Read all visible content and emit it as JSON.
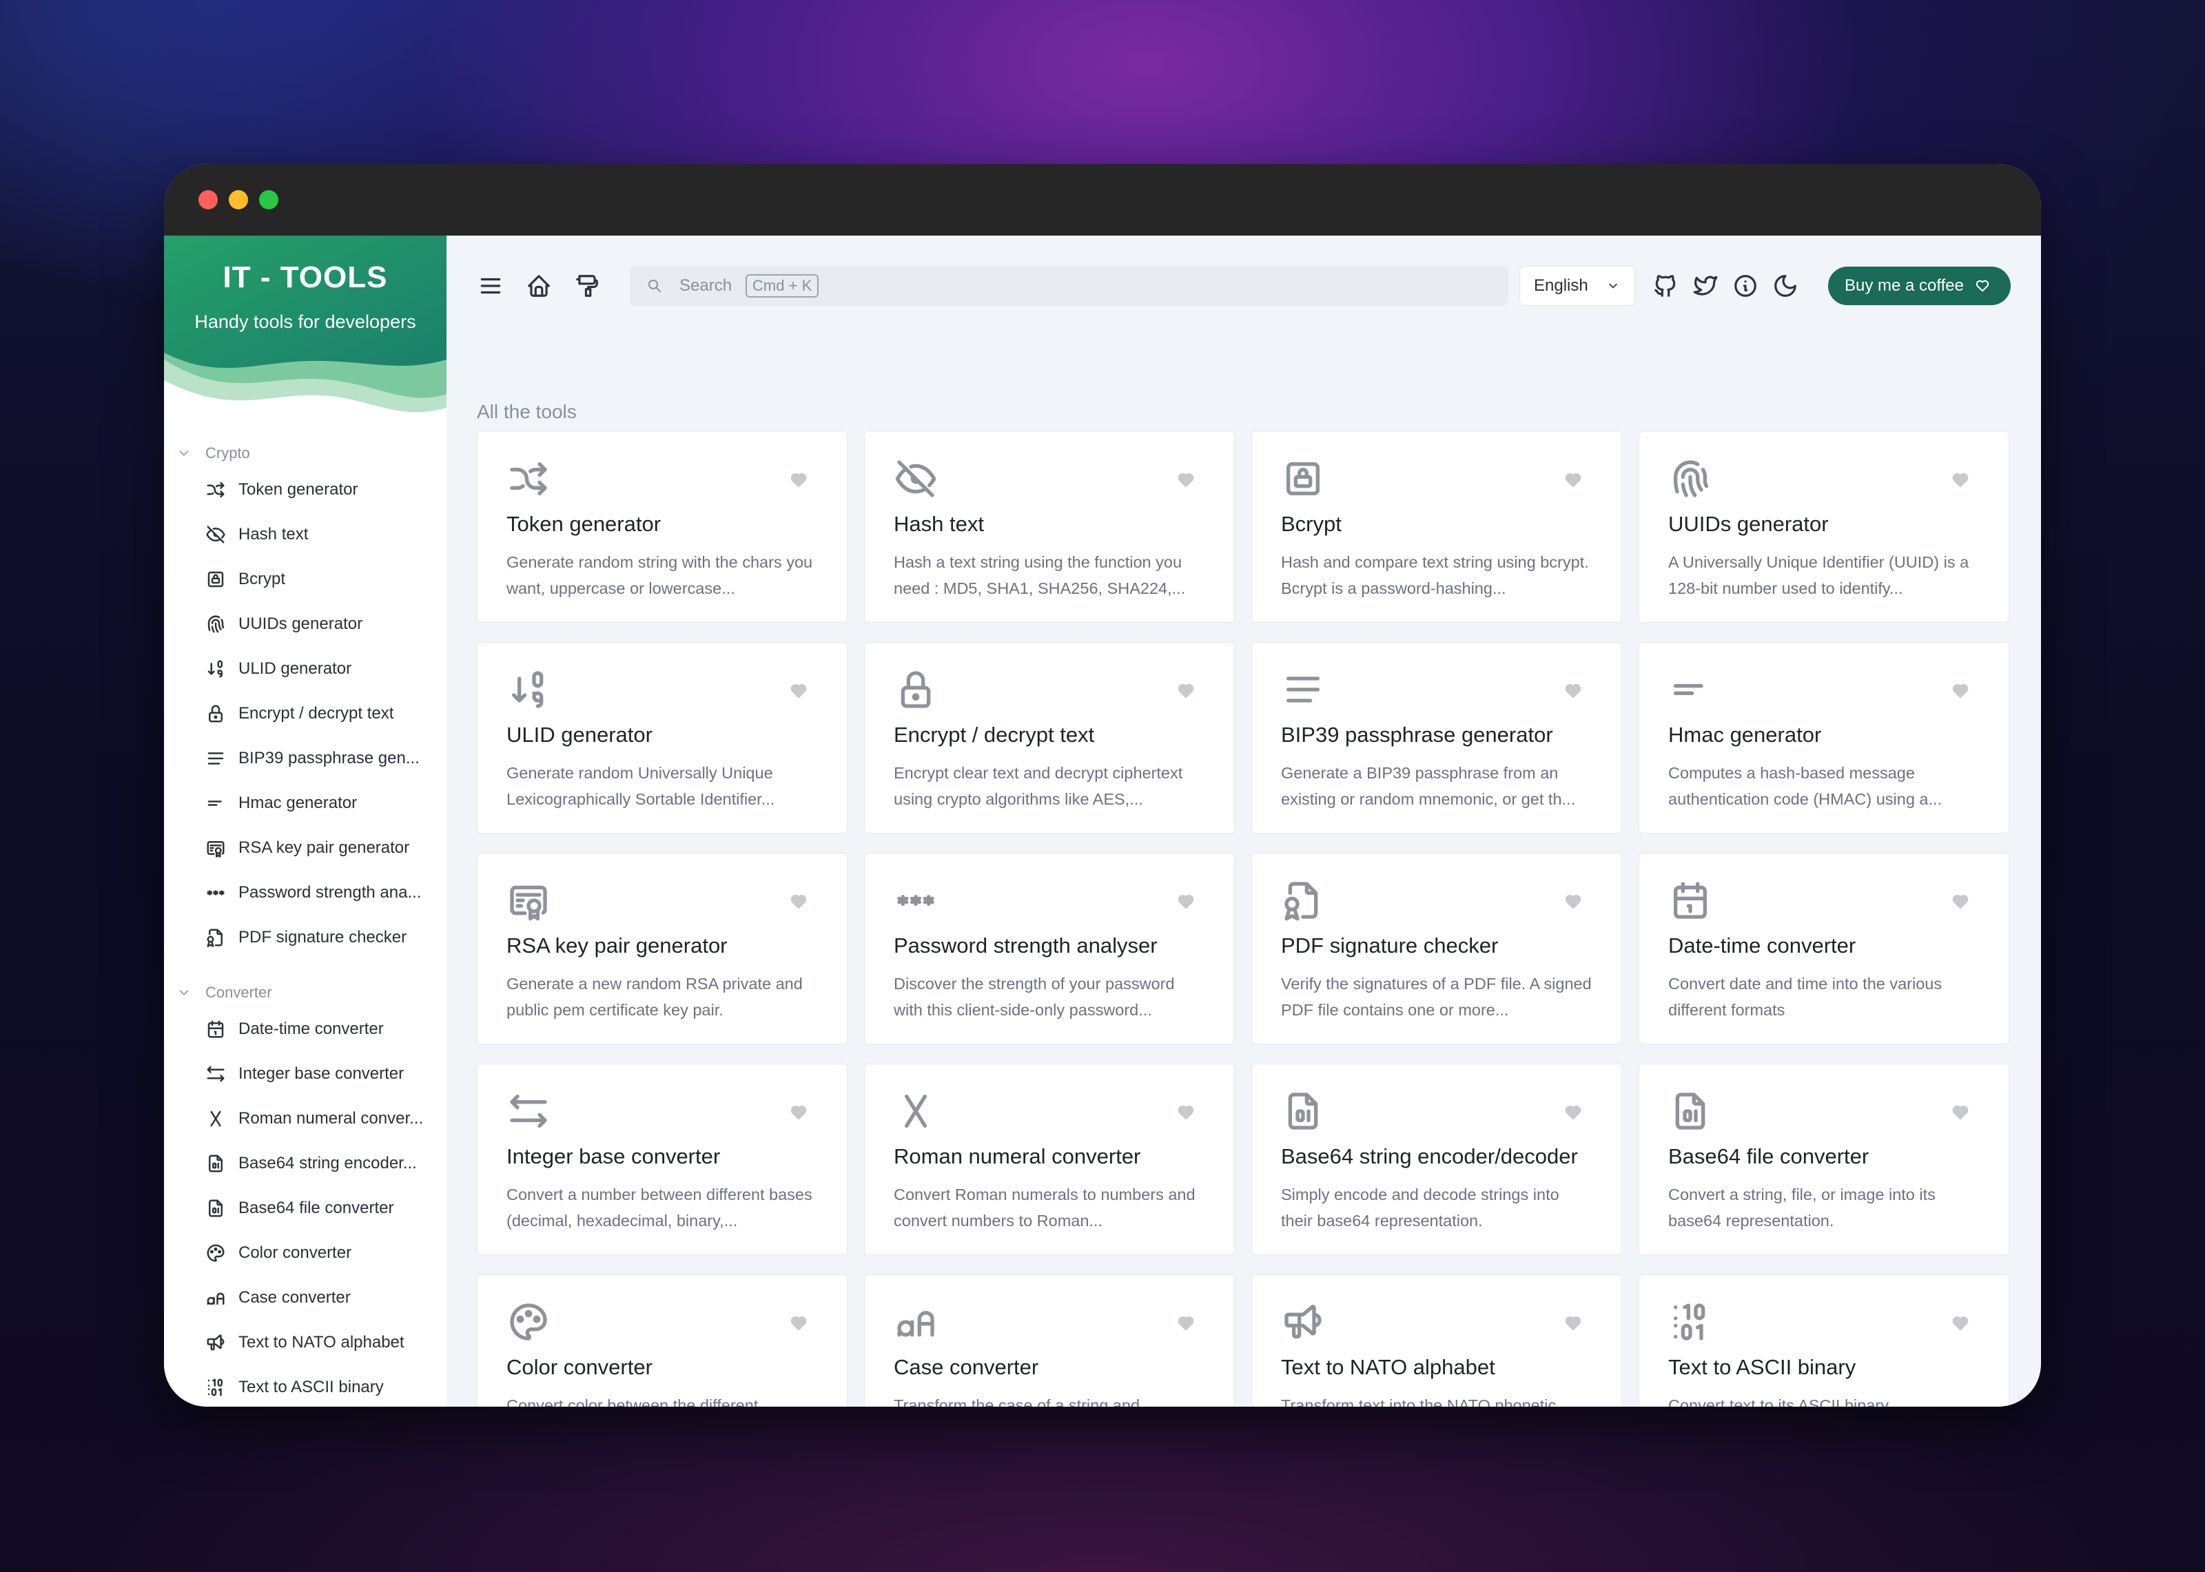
{
  "brand": {
    "title": "IT - TOOLS",
    "subtitle": "Handy tools for developers"
  },
  "search": {
    "placeholder": "Search",
    "shortcut": "Cmd + K"
  },
  "language": {
    "selected": "English"
  },
  "coffee": {
    "label": "Buy me a coffee"
  },
  "section_title": "All the tools",
  "sidebar": {
    "groups": [
      {
        "label": "Crypto",
        "items": [
          {
            "label": "Token generator",
            "icon": "shuffle-icon"
          },
          {
            "label": "Hash text",
            "icon": "eye-off-icon"
          },
          {
            "label": "Bcrypt",
            "icon": "lock-square-icon"
          },
          {
            "label": "UUIDs generator",
            "icon": "fingerprint-icon"
          },
          {
            "label": "ULID generator",
            "icon": "sort-numeric-icon"
          },
          {
            "label": "Encrypt / decrypt text",
            "icon": "lock-icon"
          },
          {
            "label": "BIP39 passphrase gen...",
            "icon": "align-justified-icon"
          },
          {
            "label": "Hmac generator",
            "icon": "short-text-icon"
          },
          {
            "label": "RSA key pair generator",
            "icon": "certificate-icon"
          },
          {
            "label": "Password strength ana...",
            "icon": "password-icon"
          },
          {
            "label": "PDF signature checker",
            "icon": "file-certificate-icon"
          }
        ]
      },
      {
        "label": "Converter",
        "items": [
          {
            "label": "Date-time converter",
            "icon": "calendar-icon"
          },
          {
            "label": "Integer base converter",
            "icon": "arrows-left-right-icon"
          },
          {
            "label": "Roman numeral conver...",
            "icon": "letter-x-icon"
          },
          {
            "label": "Base64 string encoder...",
            "icon": "file-digit-icon"
          },
          {
            "label": "Base64 file converter",
            "icon": "file-digit-icon"
          },
          {
            "label": "Color converter",
            "icon": "palette-icon"
          },
          {
            "label": "Case converter",
            "icon": "letter-case-icon"
          },
          {
            "label": "Text to NATO alphabet",
            "icon": "speakerphone-icon"
          },
          {
            "label": "Text to ASCII binary",
            "icon": "binary-icon"
          }
        ]
      }
    ]
  },
  "tools": [
    {
      "title": "Token generator",
      "desc": "Generate random string with the chars you want, uppercase or lowercase...",
      "icon": "shuffle-icon"
    },
    {
      "title": "Hash text",
      "desc": "Hash a text string using the function you need : MD5, SHA1, SHA256, SHA224,...",
      "icon": "eye-off-icon"
    },
    {
      "title": "Bcrypt",
      "desc": "Hash and compare text string using bcrypt. Bcrypt is a password-hashing...",
      "icon": "lock-square-icon"
    },
    {
      "title": "UUIDs generator",
      "desc": "A Universally Unique Identifier (UUID) is a 128-bit number used to identify...",
      "icon": "fingerprint-icon"
    },
    {
      "title": "ULID generator",
      "desc": "Generate random Universally Unique Lexicographically Sortable Identifier...",
      "icon": "sort-numeric-icon"
    },
    {
      "title": "Encrypt / decrypt text",
      "desc": "Encrypt clear text and decrypt ciphertext using crypto algorithms like AES,...",
      "icon": "lock-icon"
    },
    {
      "title": "BIP39 passphrase generator",
      "desc": "Generate a BIP39 passphrase from an existing or random mnemonic, or get th...",
      "icon": "align-justified-icon"
    },
    {
      "title": "Hmac generator",
      "desc": "Computes a hash-based message authentication code (HMAC) using a...",
      "icon": "short-text-icon"
    },
    {
      "title": "RSA key pair generator",
      "desc": "Generate a new random RSA private and public pem certificate key pair.",
      "icon": "certificate-icon"
    },
    {
      "title": "Password strength analyser",
      "desc": "Discover the strength of your password with this client-side-only password...",
      "icon": "password-icon"
    },
    {
      "title": "PDF signature checker",
      "desc": "Verify the signatures of a PDF file. A signed PDF file contains one or more...",
      "icon": "file-certificate-icon"
    },
    {
      "title": "Date-time converter",
      "desc": "Convert date and time into the various different formats",
      "icon": "calendar-icon"
    },
    {
      "title": "Integer base converter",
      "desc": "Convert a number between different bases (decimal, hexadecimal, binary,...",
      "icon": "arrows-left-right-icon"
    },
    {
      "title": "Roman numeral converter",
      "desc": "Convert Roman numerals to numbers and convert numbers to Roman...",
      "icon": "letter-x-icon"
    },
    {
      "title": "Base64 string encoder/decoder",
      "desc": "Simply encode and decode strings into their base64 representation.",
      "icon": "file-digit-icon"
    },
    {
      "title": "Base64 file converter",
      "desc": "Convert a string, file, or image into its base64 representation.",
      "icon": "file-digit-icon"
    },
    {
      "title": "Color converter",
      "desc": "Convert color between the different",
      "icon": "palette-icon"
    },
    {
      "title": "Case converter",
      "desc": "Transform the case of a string and",
      "icon": "letter-case-icon"
    },
    {
      "title": "Text to NATO alphabet",
      "desc": "Transform text into the NATO phonetic",
      "icon": "speakerphone-icon"
    },
    {
      "title": "Text to ASCII binary",
      "desc": "Convert text to its ASCII binary",
      "icon": "binary-icon"
    }
  ],
  "colors": {
    "accent": "#1a6b57",
    "brand_top": "#2a9d63",
    "brand_bottom": "#1f8a6a"
  }
}
